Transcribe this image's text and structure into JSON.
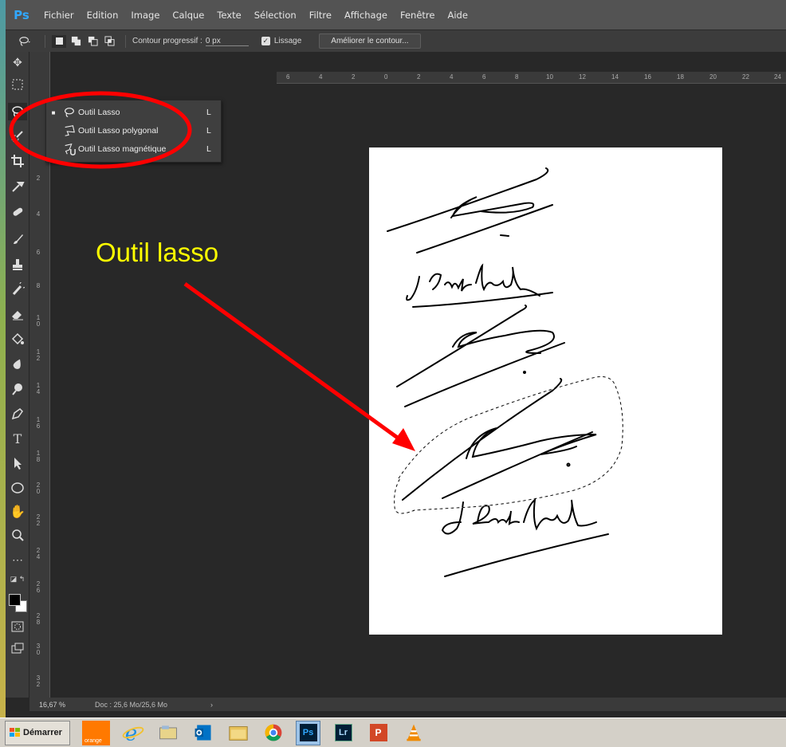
{
  "app": {
    "logo": "Ps",
    "menu": [
      "Fichier",
      "Edition",
      "Image",
      "Calque",
      "Texte",
      "Sélection",
      "Filtre",
      "Affichage",
      "Fenêtre",
      "Aide"
    ]
  },
  "options_bar": {
    "feather_label": "Contour progressif :",
    "feather_value": "0 px",
    "antialias_label": "Lissage",
    "refine_edge_label": "Améliorer le contour..."
  },
  "ruler_top_labels": [
    "6",
    "4",
    "2",
    "0",
    "2",
    "4",
    "6",
    "8",
    "10",
    "12",
    "14",
    "16",
    "18",
    "20",
    "22",
    "24"
  ],
  "ruler_left_labels": [
    "2",
    "4",
    "6",
    "8",
    "10",
    "12",
    "14",
    "16",
    "18",
    "20",
    "22",
    "24",
    "26",
    "28",
    "30",
    "32"
  ],
  "flyout": {
    "items": [
      {
        "label": "Outil Lasso",
        "key": "L",
        "selected": true,
        "icon": "lasso-icon"
      },
      {
        "label": "Outil Lasso polygonal",
        "key": "L",
        "selected": false,
        "icon": "polygonal-lasso-icon"
      },
      {
        "label": "Outil Lasso magnétique",
        "key": "L",
        "selected": false,
        "icon": "magnetic-lasso-icon"
      }
    ]
  },
  "annotation": {
    "text": "Outil lasso",
    "text_color": "#ffff00",
    "arrow_color": "#ff0000",
    "circle_color": "#ff0000"
  },
  "document": {
    "signatures": [
      "j-Paul-Vidal",
      "j-Paul Vidal"
    ]
  },
  "status": {
    "zoom": "16,67 %",
    "doc_info": "Doc : 25,6 Mo/25,6 Mo",
    "arrow": "›"
  },
  "taskbar": {
    "start_label": "Démarrer",
    "orange_label": "orange",
    "icons": [
      "orange-icon",
      "internet-explorer-icon",
      "explorer-icon",
      "outlook-icon",
      "folder-icon",
      "chrome-icon",
      "photoshop-icon",
      "lightroom-icon",
      "powerpoint-icon",
      "vlc-icon"
    ],
    "ps_label": "Ps",
    "lr_label": "Lr",
    "p_label": "P"
  },
  "colors": {
    "menubar": "#535353",
    "canvas": "#282828",
    "accent": "#31a8ff"
  }
}
